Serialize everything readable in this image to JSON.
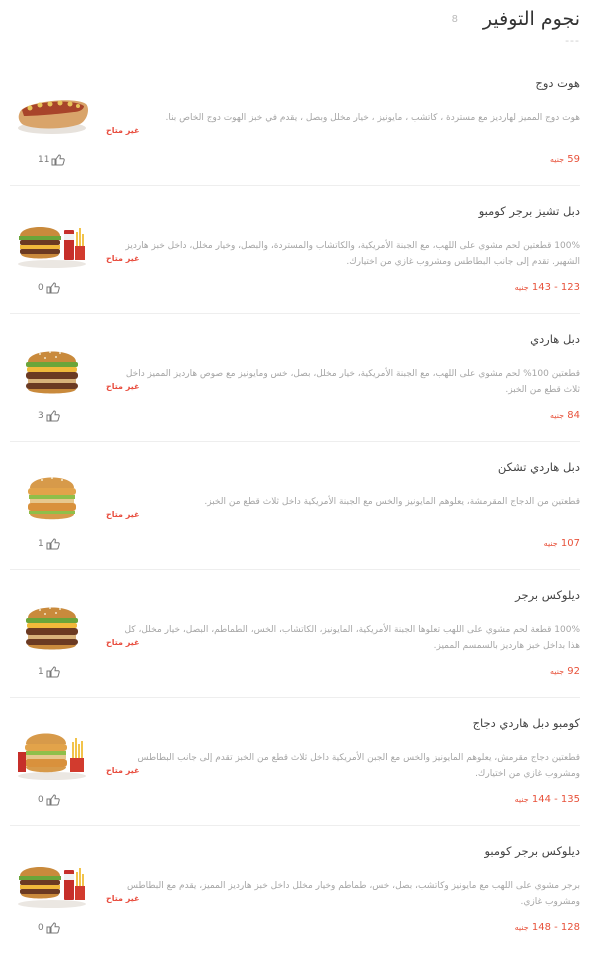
{
  "section": {
    "title": "نجوم التوفير",
    "count": "8",
    "dash": "---"
  },
  "items": [
    {
      "name": "هوت دوج",
      "desc": "هوت دوج المميز لهارديز مع مستردة ، كاتشب ، مايونيز ، خيار مخلل وبصل ، يقدم في خبز الهوت دوج الخاص بنا.",
      "price": "59",
      "unit": "جنيه",
      "status": "غير متاح",
      "likes": "11",
      "image": "hotdog"
    },
    {
      "name": "دبل تشيز برجر كومبو",
      "desc": "100% قطعتين لحم مشوي على اللهب، مع الجبنة الأمريكية، والكاتشاب والمستردة، والبصل، وخيار مخلل، داخل خبز هارديز الشهير. تقدم إلى جانب البطاطس ومشروب غازي من اختيارك.",
      "price": "123 - 143",
      "unit": "جنيه",
      "status": "غير متاح",
      "likes": "0",
      "image": "burger-combo"
    },
    {
      "name": "دبل هاردي",
      "desc": "قطعتين 100% لحم مشوي على اللهب، مع الجبنة الأمريكية، خيار مخلل، بصل، خس ومايونيز مع صوص هارديز المميز داخل ثلاث قطع من الخبز.",
      "price": "84",
      "unit": "جنيه",
      "status": "غير متاح",
      "likes": "3",
      "image": "burger"
    },
    {
      "name": "دبل هاردي تشكن",
      "desc": "قطعتين من الدجاج المقرمشة، يعلوهم المايونيز والخس مع الجبنة الأمريكية داخل ثلاث قطع من الخبز.",
      "price": "107",
      "unit": "جنيه",
      "status": "غير متاح",
      "likes": "1",
      "image": "chicken-burger"
    },
    {
      "name": "ديلوكس برجر",
      "desc": "100% قطعة لحم مشوي على اللهب تعلوها الجبنة الأمريكية، المايونيز، الكاتشاب، الخس، الطماطم، البصل، خيار مخلل، كل هذا بداخل خبز هارديز بالسمسم المميز.",
      "price": "92",
      "unit": "جنيه",
      "status": "غير متاح",
      "likes": "1",
      "image": "burger"
    },
    {
      "name": "كومبو دبل هاردي دجاج",
      "desc": "قطعتين دجاج مقرمش، يعلوهم المايونيز والخس مع الجبن الأمريكية داخل ثلاث قطع من الخبز تقدم إلى جانب البطاطس ومشروب غازي من اختيارك.",
      "price": "135 - 144",
      "unit": "جنيه",
      "status": "غير متاح",
      "likes": "0",
      "image": "chicken-combo"
    },
    {
      "name": "ديلوكس برجر كومبو",
      "desc": "برجر مشوي على اللهب مع مايونيز وكاتشب، بصل، خس، طماطم وخيار مخلل داخل خبز هارديز المميز، يقدم مع البطاطس ومشروب غازي.",
      "price": "128 - 148",
      "unit": "جنيه",
      "status": "غير متاح",
      "likes": "0",
      "image": "burger-combo"
    }
  ]
}
